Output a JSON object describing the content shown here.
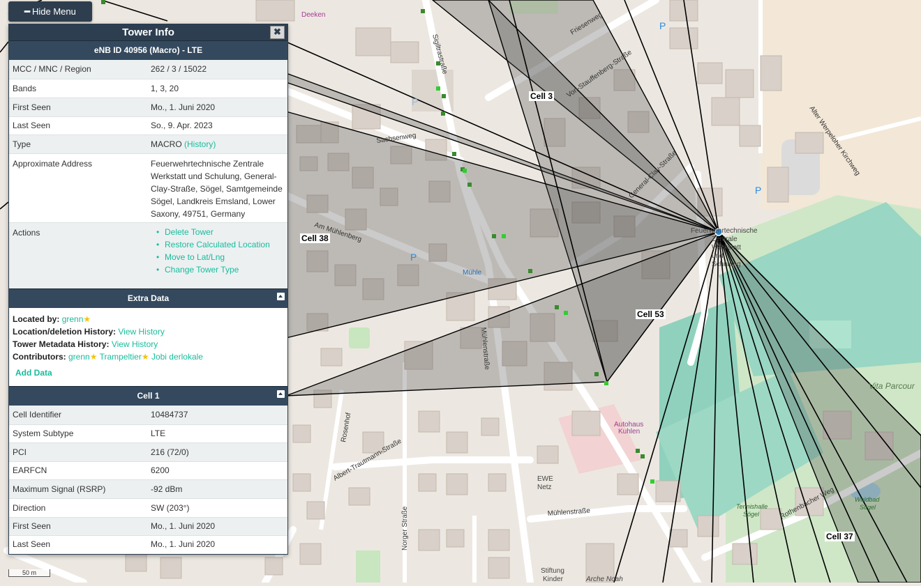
{
  "hide_menu_label": "Hide Menu",
  "panel": {
    "title": "Tower Info",
    "close": "✖",
    "tower_header": "eNB ID 40956 (Macro) - LTE",
    "tower_rows": [
      {
        "key": "MCC / MNC / Region",
        "value": "262 / 3 / 15022"
      },
      {
        "key": "Bands",
        "value": "1, 3, 20"
      },
      {
        "key": "First Seen",
        "value": "Mo., 1. Juni 2020"
      },
      {
        "key": "Last Seen",
        "value": "So., 9. Apr. 2023"
      }
    ],
    "type_key": "Type",
    "type_value": "MACRO",
    "type_link": "(History)",
    "address_key": "Approximate Address",
    "address_lines": [
      "Feuerwehrtechnische Zentrale",
      "Werkstatt und Schulung, General-",
      "Clay-Straße, Sögel, Samtgemeinde",
      "Sögel, Landkreis Emsland, Lower",
      "Saxony, 49751, Germany"
    ],
    "actions_key": "Actions",
    "actions": [
      "Delete Tower",
      "Restore Calculated Location",
      "Move to Lat/Lng",
      "Change Tower Type"
    ],
    "extra_header": "Extra Data",
    "located_by_label": "Located by:",
    "located_by_user": "grenn",
    "loc_history_label": "Location/deletion History:",
    "meta_history_label": "Tower Metadata History:",
    "view_history": "View History",
    "contributors_label": "Contributors:",
    "contributors": [
      "grenn",
      "Trampeltier",
      "Jobi derlokale"
    ],
    "add_data": "Add Data",
    "cell_header": "Cell 1",
    "cell_rows": [
      {
        "key": "Cell Identifier",
        "value": "10484737"
      },
      {
        "key": "System Subtype",
        "value": "LTE"
      },
      {
        "key": "PCI",
        "value": "216 (72/0)"
      },
      {
        "key": "EARFCN",
        "value": "6200"
      },
      {
        "key": "Maximum Signal (RSRP)",
        "value": "-92 dBm"
      },
      {
        "key": "Direction",
        "value": "SW (203°)"
      },
      {
        "key": "First Seen",
        "value": "Mo., 1. Juni 2020"
      },
      {
        "key": "Last Seen",
        "value": "Mo., 1. Juni 2020"
      }
    ]
  },
  "map": {
    "cell_labels": [
      "Cell 3",
      "Cell 38",
      "Cell 53",
      "Cell 37"
    ],
    "street_labels": [
      "Sigiltrastraße",
      "Sachsenweg",
      "Am Mühlenberg",
      "Mühlenstraße",
      "Friesenweg",
      "Von-Stauffenberg-Straße",
      "General-Clay-Straße",
      "Alter Werpeloher Kirchweg",
      "Albert-Trautmann-Straße",
      "Norger Straße",
      "Rosenhof",
      "Rothenbacher Weg",
      "Mühlenstraße"
    ],
    "poi_labels": [
      "Deeken",
      "Mühle",
      "Autohaus Kuhlen",
      "EWE Netz",
      "Stiftung Kinder",
      "Arche Noah",
      "Vita Parcour",
      "Tennishalle Sögel",
      "Waldbad Sögel",
      "Feuerwehrtechnische Zentrale Werkstatt und Schulung"
    ],
    "scale": "50 m",
    "colors": {
      "tower": "#2b8ce0",
      "sector_fill": "rgba(80,80,80,0.28)",
      "panel_header": "#2c3e50",
      "link": "#18bc9c"
    }
  }
}
